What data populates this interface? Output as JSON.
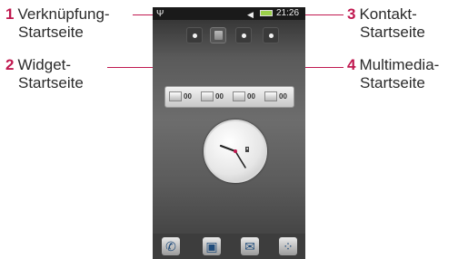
{
  "callouts": [
    {
      "num": "1",
      "line1": "Verknüpfung-",
      "line2": "Startseite"
    },
    {
      "num": "2",
      "line1": "Widget-",
      "line2": "Startseite"
    },
    {
      "num": "3",
      "line1": "Kontakt-",
      "line2": "Startseite"
    },
    {
      "num": "4",
      "line1": "Multimedia-",
      "line2": "Startseite"
    }
  ],
  "phone": {
    "status": {
      "time": "21:26"
    },
    "widget_counts": [
      "00",
      "00",
      "00",
      "00"
    ]
  }
}
